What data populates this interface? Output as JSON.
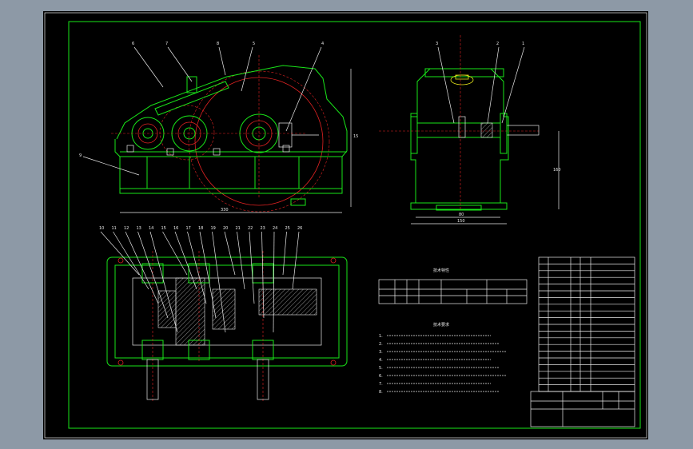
{
  "front_view": {
    "part_labels": [
      "6",
      "7",
      "8",
      "5",
      "4",
      "9"
    ],
    "dim_length": "330",
    "dim_height": "15"
  },
  "side_view": {
    "part_labels": [
      "3",
      "2",
      "1"
    ],
    "dim_width": "80",
    "dim_base": "150",
    "dim_height": "160"
  },
  "plan_view": {
    "part_labels": [
      "10",
      "11",
      "12",
      "13",
      "14",
      "15",
      "16",
      "17",
      "18",
      "19",
      "20",
      "21",
      "22",
      "23",
      "24",
      "25",
      "26"
    ]
  },
  "tech_spec": {
    "title": "技术特性"
  },
  "tech_req": {
    "title": "技术要求",
    "numbers": [
      "1.",
      "2.",
      "3.",
      "4.",
      "5.",
      "6.",
      "7.",
      "8."
    ]
  }
}
